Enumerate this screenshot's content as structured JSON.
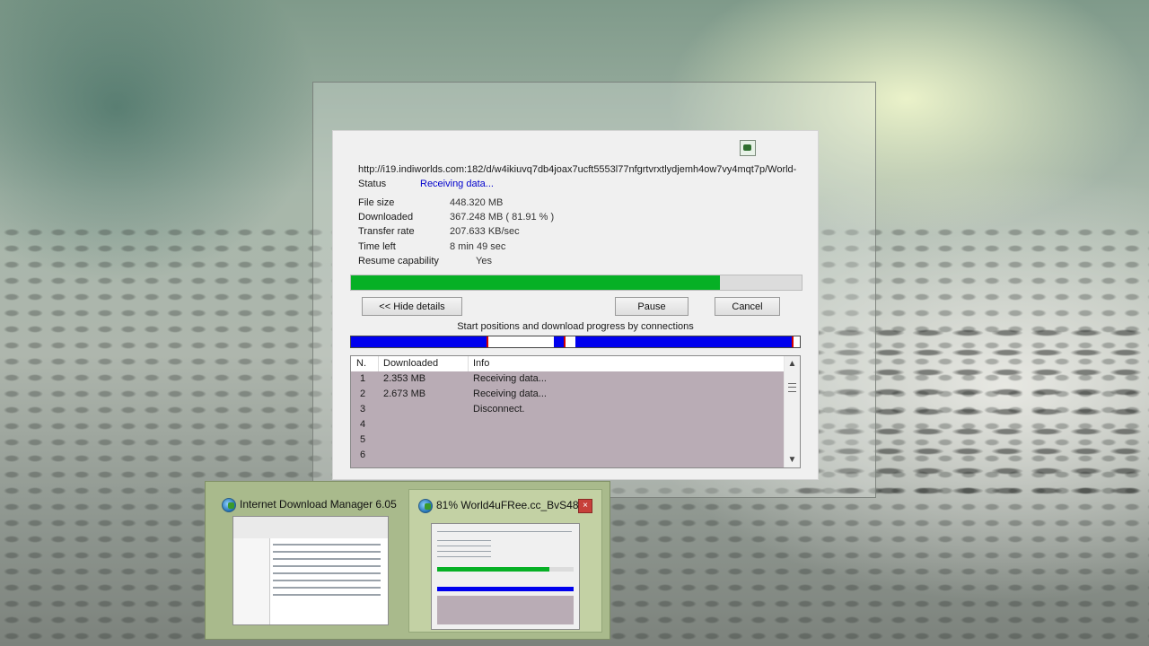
{
  "dialog": {
    "url": "http://i19.indiworlds.com:182/d/w4ikiuvq7db4joax7ucft5553l77nfgrtvrxtlydjemh4ow7vy4mqt7p/World-",
    "status_label": "Status",
    "status_value": "Receiving data...",
    "file_size_label": "File size",
    "file_size_value": "448.320  MB",
    "downloaded_label": "Downloaded",
    "downloaded_value": "367.248  MB  ( 81.91 % )",
    "transfer_rate_label": "Transfer rate",
    "transfer_rate_value": "207.633  KB/sec",
    "time_left_label": "Time left",
    "time_left_value": "8 min 49 sec",
    "resume_label": "Resume capability",
    "resume_value": "Yes",
    "progress_fraction": 0.8191,
    "hide_details_label": "<< Hide details",
    "pause_label": "Pause",
    "cancel_label": "Cancel",
    "connections_caption": "Start positions and download progress by connections",
    "accent_progress": "#06b025",
    "accent_connections": "#0000ee"
  },
  "connections_table": {
    "headers": [
      "N.",
      "Downloaded",
      "Info"
    ],
    "rows": [
      {
        "n": "1",
        "downloaded": "2.353  MB",
        "info": "Receiving data..."
      },
      {
        "n": "2",
        "downloaded": "2.673  MB",
        "info": "Receiving data..."
      },
      {
        "n": "3",
        "downloaded": "",
        "info": "Disconnect."
      },
      {
        "n": "4",
        "downloaded": "",
        "info": ""
      },
      {
        "n": "5",
        "downloaded": "",
        "info": ""
      },
      {
        "n": "6",
        "downloaded": "",
        "info": ""
      }
    ]
  },
  "taskbar_previews": {
    "items": [
      {
        "title": "Internet Download Manager 6.05",
        "icon": "idm-globe-icon"
      },
      {
        "title": "81% World4uFRee.cc_BvS48...",
        "icon": "idm-globe-icon",
        "close_label": "×"
      }
    ]
  }
}
